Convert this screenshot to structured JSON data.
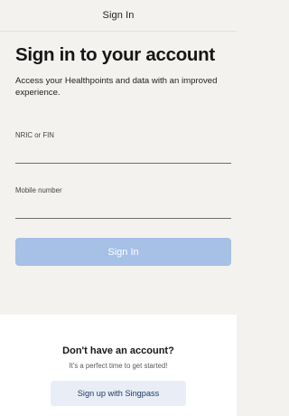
{
  "header": {
    "title": "Sign In"
  },
  "main": {
    "heading": "Sign in to your account",
    "description": "Access your Healthpoints and data with an improved experience.",
    "fields": {
      "nric": {
        "label": "NRIC or FIN",
        "value": ""
      },
      "mobile": {
        "label": "Mobile number",
        "value": ""
      }
    },
    "signin_button": "Sign In"
  },
  "footer": {
    "title": "Don't have an account?",
    "subtitle": "It's a perfect time to get started!",
    "signup_button": "Sign up with Singpass"
  },
  "colors": {
    "background": "#f4f2ef",
    "signin_button_disabled": "#a6c0e6",
    "singpass_button": "#e9eef6",
    "footer_background": "#ffffff"
  }
}
